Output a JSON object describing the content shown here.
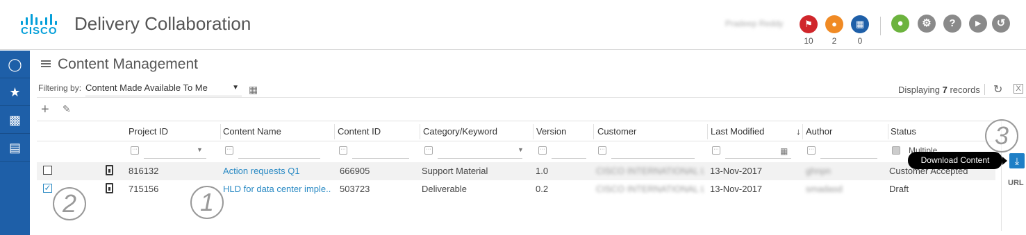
{
  "header": {
    "logo_text": "CISCO",
    "app_title": "Delivery Collaboration",
    "user_name": "Pradeep Reddy",
    "badges": [
      {
        "icon": "flag-icon",
        "count": "10",
        "color": "#d0262b"
      },
      {
        "icon": "bell-icon",
        "count": "2",
        "color": "#f08a24"
      },
      {
        "icon": "calendar-icon",
        "count": "0",
        "color": "#1e5fa8"
      }
    ],
    "icons": [
      {
        "icon": "user-icon",
        "color": "#6cb33e"
      },
      {
        "icon": "gear-icon",
        "color": "#8a8a8a"
      },
      {
        "icon": "help-icon",
        "color": "#8a8a8a"
      },
      {
        "icon": "megaphone-icon",
        "color": "#8a8a8a"
      },
      {
        "icon": "logout-icon",
        "color": "#8a8a8a"
      }
    ]
  },
  "sidebar": {
    "items": [
      {
        "icon": "expand-icon"
      },
      {
        "icon": "globe-icon"
      },
      {
        "icon": "buildings-icon"
      },
      {
        "icon": "chart-icon"
      }
    ],
    "color": "#1e5fa8"
  },
  "content": {
    "title": "Content Management",
    "filter_label": "Filtering by:",
    "filter_value": "Content Made Available To Me",
    "records_prefix": "Displaying",
    "records_count": "7",
    "records_suffix": "records"
  },
  "table": {
    "columns": [
      "Project ID",
      "Content Name",
      "Content ID",
      "Category/Keyword",
      "Version",
      "Customer",
      "Last Modified",
      "Author",
      "Status"
    ],
    "status_filter": "Multiple",
    "rows": [
      {
        "checked": false,
        "project_id": "816132",
        "content_name": "Action requests Q1",
        "content_id": "666905",
        "category": "Support Material",
        "version": "1.0",
        "customer": "CISCO INTERNATIONAL L...",
        "last_modified": "13-Nov-2017",
        "author": "ghnpn",
        "status": "Customer Accepted"
      },
      {
        "checked": true,
        "project_id": "715156",
        "content_name": "HLD for data center imple...",
        "content_id": "503723",
        "category": "Deliverable",
        "version": "0.2",
        "customer": "CISCO INTERNATIONAL L...",
        "last_modified": "13-Nov-2017",
        "author": "smadasd",
        "status": "Draft"
      }
    ]
  },
  "tooltip": "Download Content",
  "url_label": "URL",
  "callouts": [
    "1",
    "2",
    "3"
  ]
}
